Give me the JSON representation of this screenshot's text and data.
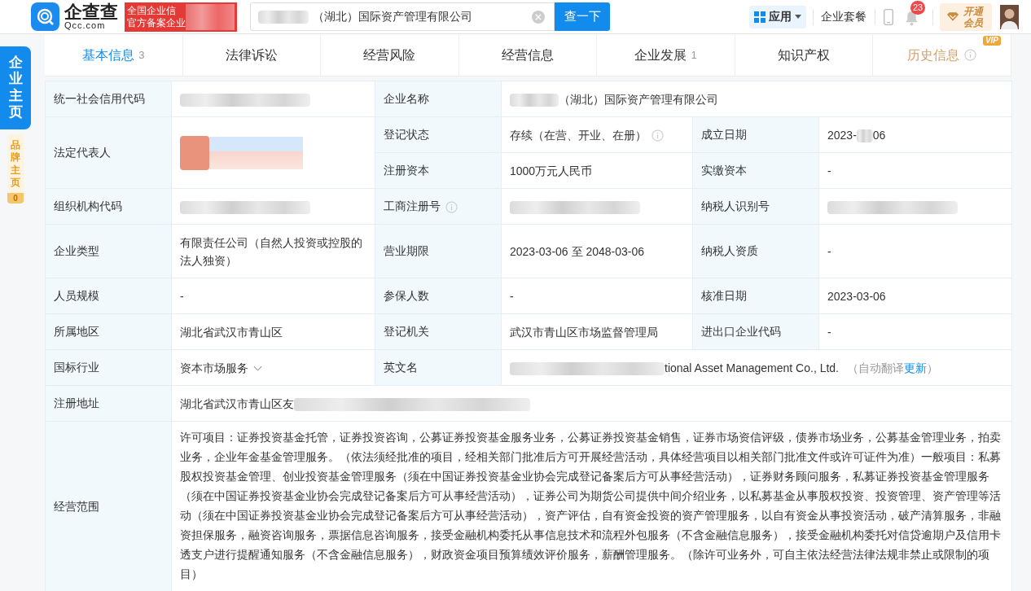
{
  "header": {
    "logo_name": "企查查",
    "logo_domain": "Qcc.com",
    "banner_lines": [
      "全国企业信",
      "官方备案企业"
    ],
    "search": {
      "value": "（湖北）国际资产管理有限公司"
    },
    "search_button": "查一下",
    "apps_button": "应用",
    "package_link": "企业套餐",
    "notification_count": "23",
    "vip_button": "开通会员"
  },
  "side_tabs": [
    {
      "label": "企业主页",
      "selected": true
    },
    {
      "label": "品牌主页",
      "count": "0",
      "selected": false
    }
  ],
  "tabs": [
    {
      "label": "基本信息",
      "count": "3",
      "selected": true
    },
    {
      "label": "法律诉讼",
      "selected": false
    },
    {
      "label": "经营风险",
      "selected": false
    },
    {
      "label": "经营信息",
      "selected": false
    },
    {
      "label": "企业发展",
      "count": "1",
      "selected": false
    },
    {
      "label": "知识产权",
      "selected": false
    },
    {
      "label": "历史信息",
      "selected": false,
      "vip": true,
      "vip_badge": "VIP"
    }
  ],
  "info_table": {
    "rows": [
      [
        {
          "kind": "label",
          "text": "统一社会信用代码"
        },
        {
          "kind": "redacted"
        },
        {
          "kind": "label",
          "text": "企业名称"
        },
        {
          "kind": "masked_prefix",
          "text": "（湖北）国际资产管理有限公司",
          "colspan": 3
        }
      ],
      [
        {
          "kind": "label",
          "text": "法定代表人",
          "rowspan": 2
        },
        {
          "kind": "redacted_person",
          "rowspan": 2
        },
        {
          "kind": "label",
          "text": "登记状态"
        },
        {
          "kind": "value",
          "text": "存续（在营、开业、在册）",
          "info": true
        },
        {
          "kind": "label",
          "text": "成立日期"
        },
        {
          "kind": "masked_middle",
          "before": "2023-",
          "after": "06"
        }
      ],
      [
        {
          "kind": "label",
          "text": "注册资本"
        },
        {
          "kind": "value",
          "text": "1000万元人民币"
        },
        {
          "kind": "label",
          "text": "实缴资本"
        },
        {
          "kind": "value",
          "text": "-"
        }
      ],
      [
        {
          "kind": "label",
          "text": "组织机构代码"
        },
        {
          "kind": "redacted"
        },
        {
          "kind": "label",
          "text": "工商注册号",
          "info": true
        },
        {
          "kind": "redacted"
        },
        {
          "kind": "label",
          "text": "纳税人识别号"
        },
        {
          "kind": "redacted"
        }
      ],
      [
        {
          "kind": "label",
          "text": "企业类型"
        },
        {
          "kind": "value",
          "text": "有限责任公司（自然人投资或控股的法人独资）"
        },
        {
          "kind": "label",
          "text": "营业期限"
        },
        {
          "kind": "value",
          "text": "2023-03-06 至 2048-03-06"
        },
        {
          "kind": "label",
          "text": "纳税人资质"
        },
        {
          "kind": "value",
          "text": "-"
        }
      ],
      [
        {
          "kind": "label",
          "text": "人员规模"
        },
        {
          "kind": "value",
          "text": "-"
        },
        {
          "kind": "label",
          "text": "参保人数"
        },
        {
          "kind": "value",
          "text": "-"
        },
        {
          "kind": "label",
          "text": "核准日期"
        },
        {
          "kind": "value",
          "text": "2023-03-06"
        }
      ],
      [
        {
          "kind": "label",
          "text": "所属地区"
        },
        {
          "kind": "value",
          "text": "湖北省武汉市青山区"
        },
        {
          "kind": "label",
          "text": "登记机关"
        },
        {
          "kind": "value",
          "text": "武汉市青山区市场监督管理局"
        },
        {
          "kind": "label",
          "text": "进出口企业代码"
        },
        {
          "kind": "value",
          "text": "-"
        }
      ],
      [
        {
          "kind": "label",
          "text": "国标行业"
        },
        {
          "kind": "dropdown",
          "text": "资本市场服务"
        },
        {
          "kind": "label",
          "text": "英文名"
        },
        {
          "kind": "masked_prefix",
          "text": "tional Asset Management Co., Ltd.",
          "note": "（自动翻译",
          "link": "更新",
          "note_end": "）",
          "colspan": 3
        }
      ],
      [
        {
          "kind": "label",
          "text": "注册地址"
        },
        {
          "kind": "masked_suffix",
          "text": "湖北省武汉市青山区友",
          "colspan": 5
        }
      ],
      [
        {
          "kind": "label",
          "text": "经营范围"
        },
        {
          "kind": "paragraph",
          "text": "许可项目：证券投资基金托管，证券投资咨询，公募证券投资基金服务业务，公募证券投资基金销售，证券市场资信评级，债券市场业务，公募基金管理业务，拍卖业务，企业年金基金管理服务。（依法须经批准的项目，经相关部门批准后方可开展经营活动，具体经营项目以相关部门批准文件或许可证件为准）一般项目：私募股权投资基金管理、创业投资基金管理服务（须在中国证券投资基金业协会完成登记备案后方可从事经营活动），证券财务顾问服务，私募证券投资基金管理服务（须在中国证券投资基金业协会完成登记备案后方可从事经营活动），证券公司为期货公司提供中间介绍业务，以私募基金从事股权投资、投资管理、资产管理等活动（须在中国证券投资基金业协会完成登记备案后方可从事经营活动），资产评估，自有资金投资的资产管理服务，以自有资金从事投资活动，破产清算服务，非融资担保服务，融资咨询服务，票据信息咨询服务，接受金融机构委托从事信息技术和流程外包服务（不含金融信息服务），接受金融机构委托对信贷逾期户及信用卡透支户进行提醒通知服务（不含金融信息服务），财政资金项目预算绩效评价服务，薪酬管理服务。（除许可业务外，可自主依法经营法律法规非禁止或限制的项目）",
          "colspan": 5
        }
      ]
    ]
  }
}
